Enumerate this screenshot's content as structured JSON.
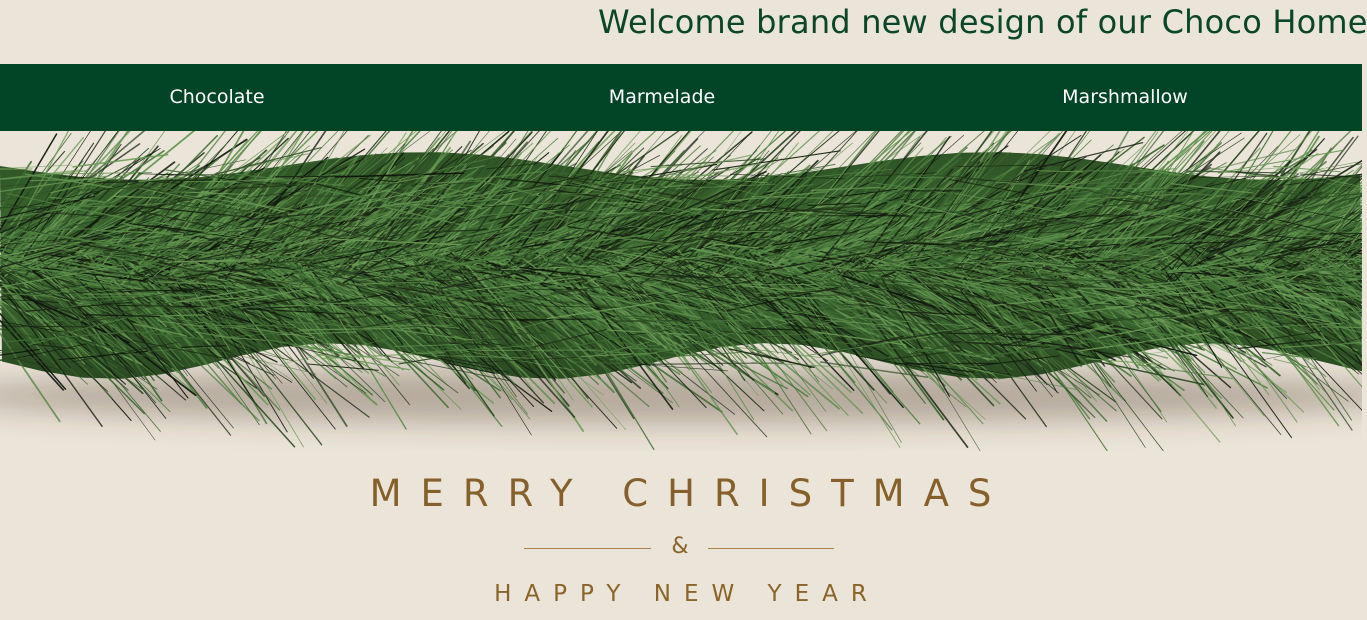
{
  "banner": {
    "text": "Welcome brand new design of our Choco Home!"
  },
  "nav": {
    "items": [
      {
        "label": "Chocolate"
      },
      {
        "label": "Marmelade"
      },
      {
        "label": "Marshmallow"
      }
    ],
    "background": "#014426"
  },
  "hero": {
    "garland_icon": "pine-garland-illustration",
    "title": "MERRY CHRISTMAS",
    "ampersand": "&",
    "subtitle": "HAPPY NEW YEAR"
  },
  "colors": {
    "page_background": "#ebe4d9",
    "banner_text": "#0a4627",
    "greeting_gold": "#8a6428",
    "pine_green": "#3f6b33"
  }
}
